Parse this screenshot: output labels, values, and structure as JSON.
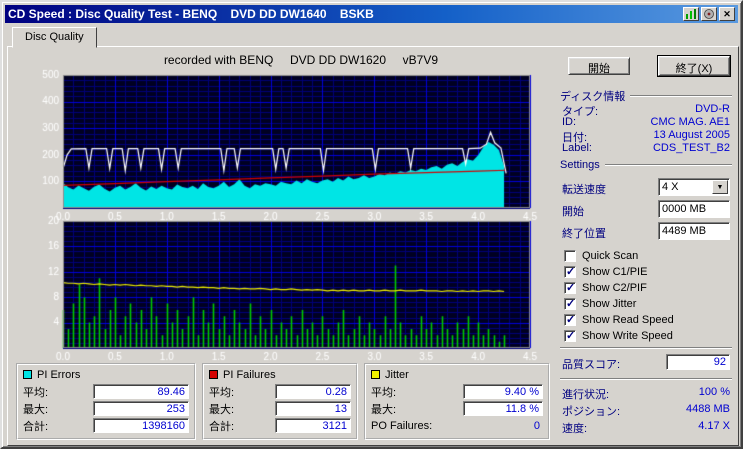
{
  "window": {
    "title": "CD Speed : Disc Quality Test - BENQ    DVD DD DW1640    BSKB",
    "close_glyph": "✕"
  },
  "tab": {
    "label": "Disc Quality"
  },
  "chart_header": "recorded with BENQ     DVD DD DW1620     vB7V9",
  "chart_data": [
    {
      "type": "area",
      "title": "C1/PIE errors with read and write speed overlay",
      "x_range": [
        0,
        4.5
      ],
      "y_range": [
        0,
        500
      ],
      "x_ticks": [
        0,
        0.5,
        1,
        1.5,
        2,
        2.5,
        3,
        3.5,
        4,
        4.5
      ],
      "y_ticks": [
        100,
        200,
        300,
        400,
        500
      ],
      "x_minor": 0.1,
      "y_minor": 20,
      "bg": "#000022",
      "grid_minor": "#00007a",
      "grid_major": "#0000dd",
      "series": [
        {
          "name": "pi-errors",
          "type": "area",
          "color": "#00e5e5",
          "x0": 0,
          "dx": 0.05,
          "values": [
            95,
            78,
            70,
            85,
            74,
            65,
            80,
            88,
            72,
            62,
            76,
            84,
            70,
            79,
            93,
            76,
            66,
            81,
            71,
            84,
            74,
            70,
            88,
            79,
            74,
            84,
            71,
            93,
            79,
            74,
            84,
            99,
            79,
            89,
            108,
            84,
            74,
            89,
            84,
            93,
            89,
            84,
            99,
            93,
            89,
            103,
            93,
            108,
            99,
            93,
            103,
            108,
            99,
            113,
            103,
            118,
            108,
            113,
            123,
            113,
            118,
            128,
            123,
            133,
            128,
            138,
            133,
            143,
            138,
            148,
            143,
            153,
            158,
            148,
            163,
            168,
            158,
            173,
            183,
            178,
            198,
            228,
            248,
            238,
            218,
            158
          ]
        },
        {
          "name": "read-speed",
          "type": "line",
          "color": "#d40000",
          "points": [
            [
              0,
              85
            ],
            [
              0.5,
              92
            ],
            [
              1.0,
              99
            ],
            [
              1.5,
              106
            ],
            [
              2.0,
              113
            ],
            [
              2.5,
              120
            ],
            [
              3.0,
              127
            ],
            [
              3.5,
              133
            ],
            [
              4.0,
              139
            ],
            [
              4.27,
              142
            ]
          ]
        },
        {
          "name": "write-speed",
          "type": "line",
          "color": "#ffffff",
          "points": [
            [
              0,
              148
            ],
            [
              0.04,
              200
            ],
            [
              0.08,
              222
            ],
            [
              0.22,
              223
            ],
            [
              0.25,
              150
            ],
            [
              0.28,
              223
            ],
            [
              0.42,
              223
            ],
            [
              0.45,
              148
            ],
            [
              0.48,
              223
            ],
            [
              0.57,
              223
            ],
            [
              0.6,
              140
            ],
            [
              0.63,
              223
            ],
            [
              0.72,
              223
            ],
            [
              0.75,
              150
            ],
            [
              0.78,
              223
            ],
            [
              0.92,
              223
            ],
            [
              0.95,
              145
            ],
            [
              0.98,
              223
            ],
            [
              1.08,
              223
            ],
            [
              1.11,
              150
            ],
            [
              1.14,
              223
            ],
            [
              1.52,
              223
            ],
            [
              1.55,
              140
            ],
            [
              1.58,
              223
            ],
            [
              1.65,
              223
            ],
            [
              1.68,
              150
            ],
            [
              1.71,
              223
            ],
            [
              2.02,
              223
            ],
            [
              2.05,
              145
            ],
            [
              2.08,
              223
            ],
            [
              2.12,
              223
            ],
            [
              2.15,
              150
            ],
            [
              2.18,
              223
            ],
            [
              2.48,
              223
            ],
            [
              2.51,
              140
            ],
            [
              2.54,
              223
            ],
            [
              2.98,
              223
            ],
            [
              3.01,
              145
            ],
            [
              3.04,
              223
            ],
            [
              3.32,
              223
            ],
            [
              3.35,
              150
            ],
            [
              3.38,
              223
            ],
            [
              3.85,
              223
            ],
            [
              3.88,
              165
            ],
            [
              3.91,
              223
            ],
            [
              4.02,
              225
            ],
            [
              4.08,
              240
            ],
            [
              4.12,
              285
            ],
            [
              4.16,
              245
            ],
            [
              4.22,
              225
            ],
            [
              4.27,
              130
            ]
          ]
        }
      ]
    },
    {
      "type": "bars",
      "title": "C2/PIF failures with jitter overlay",
      "x_range": [
        0,
        4.5
      ],
      "y_range": [
        0,
        20
      ],
      "x_ticks": [
        0,
        0.5,
        1,
        1.5,
        2,
        2.5,
        3,
        3.5,
        4,
        4.5
      ],
      "y_ticks": [
        4,
        8,
        12,
        16,
        20
      ],
      "x_minor": 0.1,
      "y_minor": 0.8,
      "bg": "#000022",
      "grid_minor": "#00007a",
      "grid_major": "#0000dd",
      "series": [
        {
          "name": "pi-failures",
          "type": "bars",
          "color": "#00cc00",
          "x0": 0,
          "dx": 0.05,
          "values": [
            6,
            3,
            7,
            10,
            8,
            4,
            5,
            11,
            3,
            6,
            8,
            2,
            5,
            7,
            4,
            6,
            3,
            8,
            5,
            2,
            7,
            4,
            6,
            3,
            5,
            8,
            2,
            6,
            4,
            7,
            3,
            5,
            2,
            6,
            4,
            3,
            7,
            2,
            5,
            3,
            6,
            2,
            4,
            3,
            5,
            2,
            6,
            3,
            4,
            2,
            5,
            3,
            2,
            4,
            6,
            2,
            3,
            5,
            2,
            4,
            3,
            2,
            5,
            3,
            13,
            4,
            2,
            3,
            2,
            5,
            3,
            4,
            2,
            5,
            3,
            2,
            4,
            3,
            5,
            2,
            4,
            2,
            3,
            2,
            1,
            2
          ]
        },
        {
          "name": "jitter",
          "type": "line",
          "color": "#f0f000",
          "x0": 0,
          "dx": 0.05,
          "values": [
            10.3,
            10.2,
            10.2,
            10.1,
            10.2,
            10.1,
            10.0,
            10.1,
            10.0,
            9.9,
            10.0,
            9.9,
            10.0,
            9.9,
            9.8,
            9.9,
            9.8,
            9.8,
            9.7,
            9.8,
            9.7,
            9.7,
            9.6,
            9.7,
            9.6,
            9.6,
            9.5,
            9.6,
            9.5,
            9.5,
            9.4,
            9.5,
            9.4,
            9.4,
            9.3,
            9.4,
            9.3,
            9.3,
            9.4,
            9.3,
            9.2,
            9.3,
            9.2,
            9.2,
            9.3,
            9.2,
            9.1,
            9.2,
            9.1,
            9.2,
            9.1,
            9.0,
            9.1,
            9.0,
            9.1,
            9.0,
            9.1,
            9.0,
            9.0,
            9.1,
            9.0,
            9.0,
            9.1,
            9.0,
            9.0,
            9.1,
            9.0,
            9.0,
            9.0,
            9.1,
            9.0,
            9.0,
            9.0,
            8.9,
            9.0,
            9.0,
            8.9,
            9.0,
            8.9,
            9.0,
            8.9,
            9.0,
            9.0,
            8.9,
            9.0,
            8.9
          ]
        }
      ]
    }
  ],
  "actions": {
    "start": "開始",
    "exit": "終了(X)"
  },
  "disc_info": {
    "header": "ディスク情報",
    "rows": [
      {
        "label": "タイプ:",
        "value": "DVD-R"
      },
      {
        "label": "ID:",
        "value": "CMC MAG. AE1"
      },
      {
        "label": "日付:",
        "value": "13 August 2005"
      },
      {
        "label": "Label:",
        "value": "CDS_TEST_B2"
      }
    ]
  },
  "settings": {
    "header": "Settings",
    "speed_label": "転送速度",
    "speed_value": "4 X",
    "start_label": "開始",
    "start_value": "0000 MB",
    "end_label": "終了位置",
    "end_value": "4489 MB",
    "checkboxes": [
      {
        "label": "Quick Scan",
        "checked": false
      },
      {
        "label": "Show C1/PIE",
        "checked": true
      },
      {
        "label": "Show C2/PIF",
        "checked": true
      },
      {
        "label": "Show Jitter",
        "checked": true
      },
      {
        "label": "Show Read Speed",
        "checked": true
      },
      {
        "label": "Show Write Speed",
        "checked": true
      }
    ]
  },
  "score": {
    "label": "品質スコア:",
    "value": "92"
  },
  "progress": {
    "rows": [
      {
        "label": "進行状況:",
        "value": "100 %"
      },
      {
        "label": "ポジション:",
        "value": "4488 MB"
      },
      {
        "label": "速度:",
        "value": "4.17 X"
      }
    ]
  },
  "stats": {
    "groups": [
      {
        "name": "PI Errors",
        "swatch": "#00e5e5",
        "rows": [
          {
            "label": "平均:",
            "value": "89.46"
          },
          {
            "label": "最大:",
            "value": "253"
          },
          {
            "label": "合計:",
            "value": "1398160"
          }
        ]
      },
      {
        "name": "PI Failures",
        "swatch": "#d40000",
        "rows": [
          {
            "label": "平均:",
            "value": "0.28"
          },
          {
            "label": "最大:",
            "value": "13"
          },
          {
            "label": "合計:",
            "value": "3121"
          }
        ]
      },
      {
        "name": "Jitter",
        "swatch": "#f0f000",
        "rows": [
          {
            "label": "平均:",
            "value": "9.40 %"
          },
          {
            "label": "最大:",
            "value": "11.8 %"
          },
          {
            "label": "PO Failures:",
            "value": "0",
            "plain": true
          }
        ]
      }
    ]
  }
}
